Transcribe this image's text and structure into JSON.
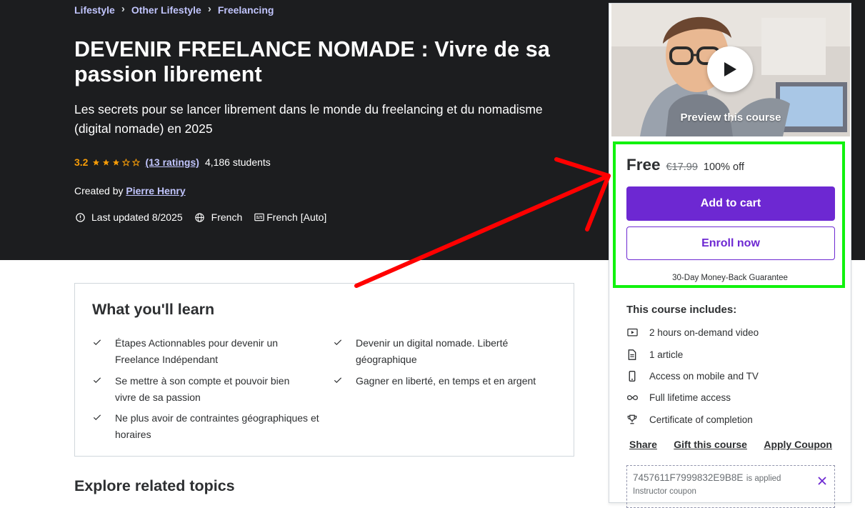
{
  "breadcrumb": [
    "Lifestyle",
    "Other Lifestyle",
    "Freelancing"
  ],
  "breadcrumb_sep": "›",
  "course": {
    "title": "DEVENIR FREELANCE NOMADE : Vivre de sa passion librement",
    "subtitle": "Les secrets pour se lancer librement dans le monde du freelancing et du nomadisme (digital nomade) en 2025",
    "rating": "3.2",
    "rating_value": 3.2,
    "ratings_count": "(13 ratings)",
    "students": "4,186 students",
    "created_by_label": "Created by",
    "instructor": "Pierre Henry",
    "last_updated": "Last updated 8/2025",
    "language": "French",
    "captions": "French [Auto]"
  },
  "learn": {
    "title": "What you'll learn",
    "items": [
      "Étapes Actionnables pour devenir un Freelance Indépendant",
      "Devenir un digital nomade. Liberté géographique",
      "Se mettre à son compte et pouvoir bien vivre de sa passion",
      "Gagner en liberté, en temps et en argent",
      "Ne plus avoir de contraintes géographiques et horaires"
    ]
  },
  "related_title": "Explore related topics",
  "sidebar": {
    "preview_label": "Preview this course",
    "price": "Free",
    "original_price": "€17.99",
    "discount": "100% off",
    "add_to_cart": "Add to cart",
    "enroll_now": "Enroll now",
    "guarantee": "30-Day Money-Back Guarantee",
    "includes_title": "This course includes:",
    "includes": [
      {
        "icon": "video-icon",
        "label": "2 hours on-demand video"
      },
      {
        "icon": "article-icon",
        "label": "1 article"
      },
      {
        "icon": "mobile-icon",
        "label": "Access on mobile and TV"
      },
      {
        "icon": "infinity-icon",
        "label": "Full lifetime access"
      },
      {
        "icon": "trophy-icon",
        "label": "Certificate of completion"
      }
    ],
    "share": "Share",
    "gift": "Gift this course",
    "apply_coupon": "Apply Coupon",
    "coupon_code": "7457611F7999832E9B8E",
    "coupon_applied": "is applied",
    "coupon_type": "Instructor coupon"
  },
  "colors": {
    "hero_bg": "#1c1d1f",
    "accent_purple": "#6d28d2",
    "link_lilac": "#c0c4fc",
    "star_orange": "#f69c08",
    "annotation_green": "#11f20e",
    "annotation_red": "#ff0000"
  }
}
